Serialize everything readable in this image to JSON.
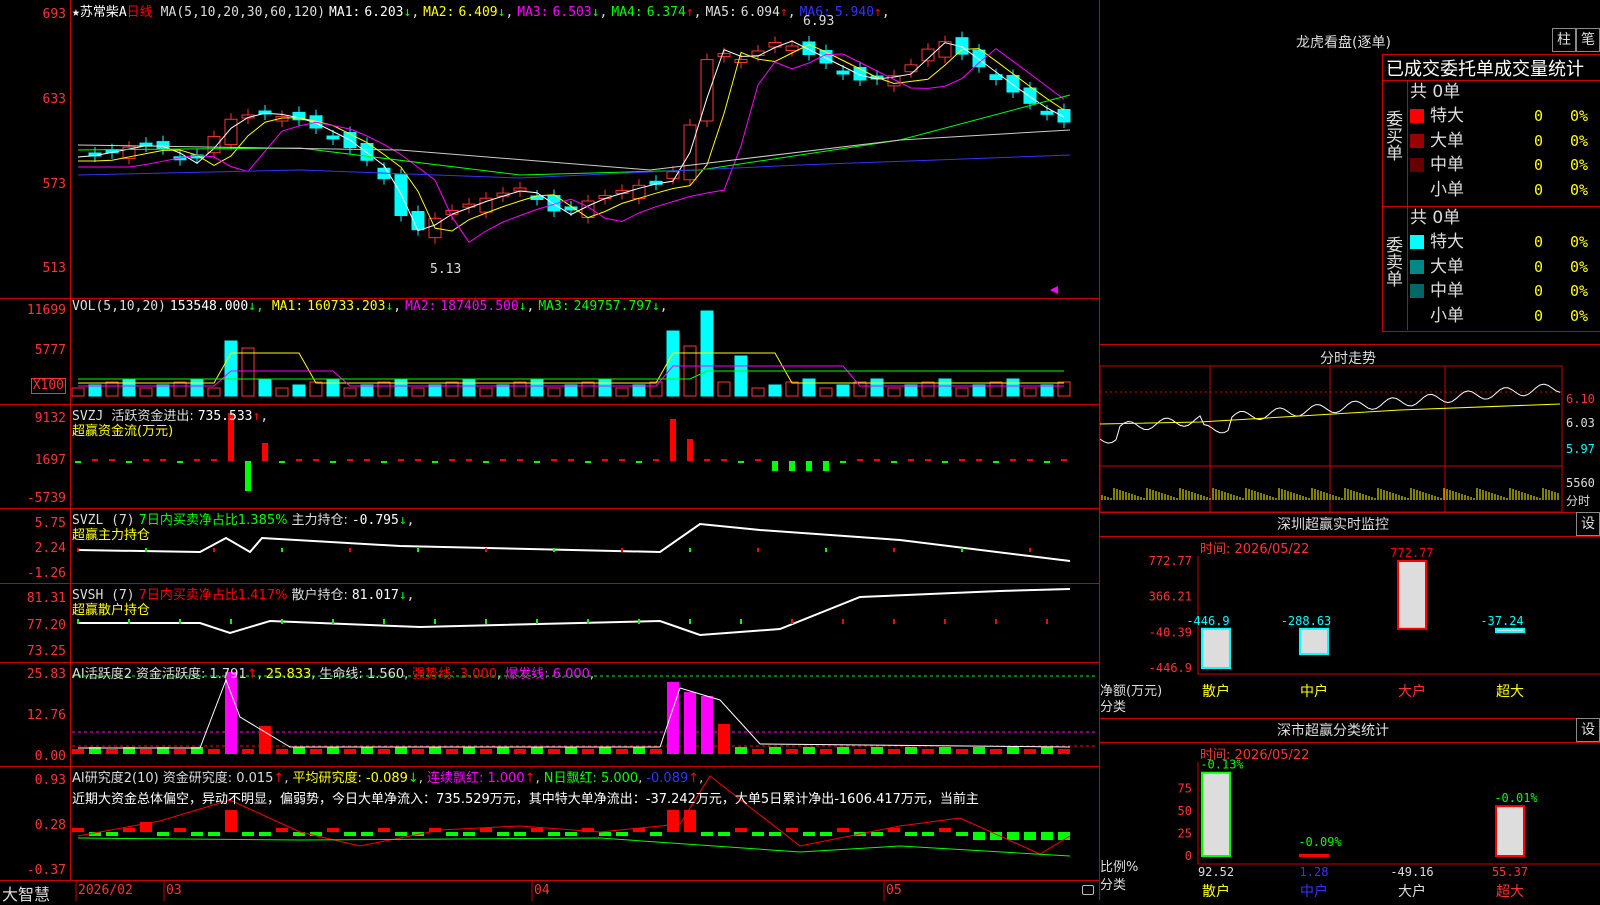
{
  "app": {
    "brand": "大智慧"
  },
  "main": {
    "stock_name": "★苏常柴A",
    "period": "日线",
    "ma_params": "MA(5,10,20,30,60,120)",
    "ma": [
      {
        "label": "MA1:",
        "value": "6.203",
        "arrow": "↓",
        "color": "#ffffff"
      },
      {
        "label": "MA2:",
        "value": "6.409",
        "arrow": "↓",
        "color": "#ffff00"
      },
      {
        "label": "MA3:",
        "value": "6.503",
        "arrow": "↓",
        "color": "#ff00ff"
      },
      {
        "label": "MA4:",
        "value": "6.374",
        "arrow": "↑",
        "color": "#00ff00"
      },
      {
        "label": "MA5:",
        "value": "6.094",
        "arrow": "↑",
        "color": "#dddddd"
      },
      {
        "label": "MA6:",
        "value": "5.940",
        "arrow": "↑",
        "color": "#3333ff"
      }
    ],
    "y_ticks": [
      "693",
      "633",
      "573",
      "513"
    ],
    "high_label": "6.93",
    "low_label": "5.13"
  },
  "vol": {
    "header": "VOL(5,10,20)",
    "value": "153548.000",
    "ma": [
      {
        "label": "MA1:",
        "value": "160733.203",
        "arrow": "↓",
        "color": "#ffff00"
      },
      {
        "label": "MA2:",
        "value": "187405.500",
        "arrow": "↓",
        "color": "#ff00ff"
      },
      {
        "label": "MA3:",
        "value": "249757.797",
        "arrow": "↓",
        "color": "#00ff00"
      }
    ],
    "y_ticks": [
      "11699",
      "5777"
    ],
    "unit": "X100"
  },
  "svzj": {
    "header": "SVZJ",
    "label": "活跃资金进出:",
    "value": "735.533",
    "arrow": "↑",
    "sub": "超赢资金流(万元)",
    "y_ticks": [
      "9132",
      "1697",
      "-5739"
    ]
  },
  "svzl": {
    "header": "SVZL (7)",
    "label1": "7日内买卖净占比1.385%",
    "label2": "主力持仓:",
    "value": "-0.795",
    "arrow": "↓",
    "sub": "超赢主力持仓",
    "y_ticks": [
      "5.75",
      "2.24",
      "-1.26"
    ]
  },
  "svsh": {
    "header": "SVSH (7)",
    "label1": "7日内买卖净占比1.417%",
    "label2": "散户持仓:",
    "value": "81.017",
    "arrow": "↓",
    "sub": "超赢散户持仓",
    "y_ticks": [
      "81.31",
      "77.20",
      "73.25"
    ]
  },
  "ai_act": {
    "header": "AI活跃度2",
    "items": [
      {
        "text": "资金活跃度: 1.791",
        "arrow": "↑",
        "color": "#dddddd"
      },
      {
        "text": "25.833",
        "arrow": "",
        "color": "#ffff00"
      },
      {
        "text": "生命线: 1.560",
        "arrow": "",
        "color": "#dddddd"
      },
      {
        "text": "强势线: 3.000",
        "arrow": "",
        "color": "#ff0000"
      },
      {
        "text": "爆发线: 6.000",
        "arrow": "",
        "color": "#ff00ff"
      }
    ],
    "y_ticks": [
      "25.83",
      "12.76",
      "0.00"
    ]
  },
  "ai_res": {
    "header": "AI研究度2(10)",
    "items": [
      {
        "text": "资金研究度: 0.015",
        "arrow": "↑",
        "color": "#dddddd"
      },
      {
        "text": "平均研究度: -0.089",
        "arrow": "↓",
        "color": "#ffff00"
      },
      {
        "text": "连续飘红: 1.000",
        "arrow": "↑",
        "color": "#ff00ff"
      },
      {
        "text": "N日飘红: 5.000",
        "arrow": "",
        "color": "#00ff00"
      },
      {
        "text": "-0.089",
        "arrow": "↑",
        "color": "#3333ff"
      }
    ],
    "comment": "近期大资金总体偏空，异动不明显，偏弱势，今日大单净流入：735.529万元，其中特大单净流出：-37.242万元，大单5日累计净出-1606.417万元，当前主",
    "y_ticks": [
      "0.93",
      "0.28",
      "-0.37"
    ]
  },
  "date_axis": [
    "2026/02",
    "03",
    "04",
    "05"
  ],
  "right": {
    "lhb_title": "龙虎看盘(逐单)",
    "btn_zhu": "柱",
    "btn_bi": "笔",
    "stats_title": "已成交委托单成交量统计",
    "buy_label": "委买单",
    "sell_label": "委卖单",
    "total_buy": "共 0单",
    "total_sell": "共 0单",
    "buy_rows": [
      {
        "name": "特大",
        "count": "0",
        "pct": "0%",
        "color": "#ff0000"
      },
      {
        "name": "大单",
        "count": "0",
        "pct": "0%",
        "color": "#990000"
      },
      {
        "name": "中单",
        "count": "0",
        "pct": "0%",
        "color": "#660000"
      },
      {
        "name": "小单",
        "count": "0",
        "pct": "0%",
        "color": "#000000"
      }
    ],
    "sell_rows": [
      {
        "name": "特大",
        "count": "0",
        "pct": "0%",
        "color": "#00ffff"
      },
      {
        "name": "大单",
        "count": "0",
        "pct": "0%",
        "color": "#008888"
      },
      {
        "name": "中单",
        "count": "0",
        "pct": "0%",
        "color": "#006666"
      },
      {
        "name": "小单",
        "count": "0",
        "pct": "0%",
        "color": "#000000"
      }
    ],
    "intraday_title": "分时走势",
    "intraday_ticks": [
      "6.10",
      "6.03",
      "5.97",
      "5560",
      "分时"
    ],
    "sz_title": "深圳超赢实时监控",
    "sz_btn": "设",
    "sz_time": "时间: 2026/05/22",
    "sz_ticks": [
      "772.77",
      "366.21",
      "-40.39",
      "-446.9"
    ],
    "sz_values": [
      "-446.9",
      "-288.63",
      "772.77",
      "-37.24"
    ],
    "sz_ylabel1": "净额(万元)",
    "sz_ylabel2": "分类",
    "categories": [
      "散户",
      "中户",
      "大户",
      "超大"
    ],
    "sz_net": [
      -446.9,
      -288.63,
      772.77,
      -37.24
    ],
    "cls_title": "深市超赢分类统计",
    "cls_btn": "设",
    "cls_time": "时间: 2026/05/22",
    "cls_ticks": [
      "75",
      "50",
      "25",
      "0"
    ],
    "cls_top": [
      "-0.13%",
      "-0.09%",
      "",
      "-0.01%"
    ],
    "cls_bottom": [
      "92.52",
      "1.28",
      "-49.16",
      "55.37"
    ],
    "cls_vals": [
      92.52,
      1.28,
      -49.16,
      55.37
    ],
    "cls_ylabel1": "比例%",
    "cls_ylabel2": "分类"
  }
}
